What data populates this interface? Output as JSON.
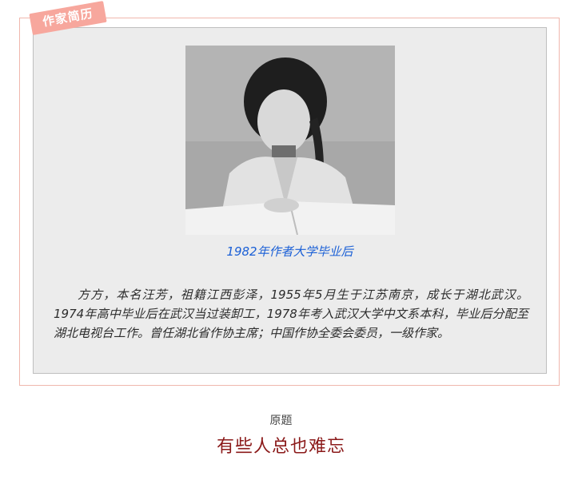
{
  "profile_section": {
    "tag_label": "作家简历",
    "photo_caption": "1982年作者大学毕业后",
    "bio_text": "方方，本名汪芳，祖籍江西彭泽，1955年5月生于江苏南京，成长于湖北武汉。1974年高中毕业后在武汉当过装卸工，1978年考入武汉大学中文系本科，毕业后分配至湖北电视台工作。曾任湖北省作协主席；中国作协全委会委员，一级作家。"
  },
  "article": {
    "original_title_label": "原题",
    "title": "有些人总也难忘"
  },
  "colors": {
    "tag_background": "#f7a79d",
    "frame_border": "#f0b7ad",
    "panel_background": "#ececec",
    "caption_color": "#1a5fd6",
    "title_color": "#8b1a1a"
  }
}
